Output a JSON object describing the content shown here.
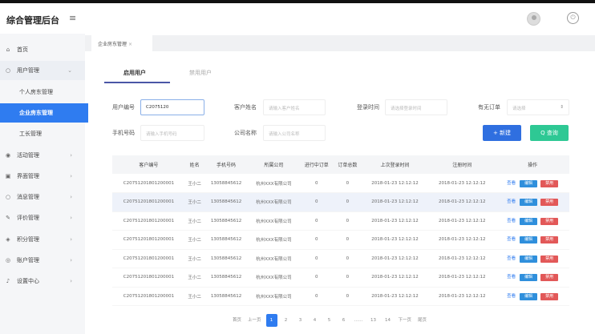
{
  "header": {
    "title": "综合管理后台",
    "menu_icon": "≡"
  },
  "sidebar": {
    "items": [
      {
        "icon": "⌂",
        "label": "首页"
      },
      {
        "icon": "○",
        "label": "用户管理",
        "arrow": "⌄"
      },
      {
        "label": "个人房东管理"
      },
      {
        "label": "企业房东管理"
      },
      {
        "label": "工长管理"
      },
      {
        "icon": "◉",
        "label": "活动管理",
        "arrow": "›"
      },
      {
        "icon": "▣",
        "label": "界面管理",
        "arrow": "›"
      },
      {
        "icon": "○",
        "label": "消息管理",
        "arrow": "›"
      },
      {
        "icon": "✎",
        "label": "评价管理",
        "arrow": "›"
      },
      {
        "icon": "◈",
        "label": "积分管理",
        "arrow": "›"
      },
      {
        "icon": "◎",
        "label": "账户管理",
        "arrow": "›"
      },
      {
        "icon": "♪",
        "label": "设置中心",
        "arrow": "›"
      }
    ]
  },
  "page_tab": {
    "label": "企业房东管理",
    "close": "×"
  },
  "subtabs": [
    "启用用户",
    "禁用用户"
  ],
  "form": {
    "customer_id": {
      "label": "用户编号",
      "value": "C2075120"
    },
    "customer_name": {
      "label": "客户姓名",
      "placeholder": "请输入客户姓名"
    },
    "login_time": {
      "label": "登录时间",
      "placeholder": "请选择登录时间"
    },
    "has_order": {
      "label": "有无订单",
      "placeholder": "请选择",
      "arrow": "⇕"
    },
    "phone": {
      "label": "手机号码",
      "placeholder": "请输入手机号码"
    },
    "company": {
      "label": "公司名称",
      "placeholder": "请输入公司名称"
    },
    "new_button": "+ 新建",
    "search_button": "Q 查询"
  },
  "table": {
    "headers": [
      "客户编号",
      "姓名",
      "手机号码",
      "所属公司",
      "进行中订单",
      "订单总数",
      "上次登录时间",
      "注册时间",
      "操作"
    ],
    "rows": [
      [
        "C20751201801200001",
        "王小二",
        "13058845612",
        "杭州XXX有限公司",
        "0",
        "0",
        "2018-01-23  12:12:12",
        "2018-01-23  12:12:12"
      ],
      [
        "C20751201801200001",
        "王小二",
        "13058845612",
        "杭州XXX有限公司",
        "0",
        "0",
        "2018-01-23  12:12:12",
        "2018-01-23  12:12:12"
      ],
      [
        "C20751201801200001",
        "王小二",
        "13058845612",
        "杭州XXX有限公司",
        "0",
        "0",
        "2018-01-23  12:12:12",
        "2018-01-23  12:12:12"
      ],
      [
        "C20751201801200001",
        "王小二",
        "13058845612",
        "杭州XXX有限公司",
        "0",
        "0",
        "2018-01-23  12:12:12",
        "2018-01-23  12:12:12"
      ],
      [
        "C20751201801200001",
        "王小二",
        "13058845612",
        "杭州XXX有限公司",
        "0",
        "0",
        "2018-01-23  12:12:12",
        "2018-01-23  12:12:12"
      ],
      [
        "C20751201801200001",
        "王小二",
        "13058845612",
        "杭州XXX有限公司",
        "0",
        "0",
        "2018-01-23  12:12:12",
        "2018-01-23  12:12:12"
      ],
      [
        "C20751201801200001",
        "王小二",
        "13058845612",
        "杭州XXX有限公司",
        "0",
        "0",
        "2018-01-23  12:12:12",
        "2018-01-23  12:12:12"
      ]
    ],
    "actions": {
      "view": "查看",
      "edit": "编辑",
      "disable": "禁用"
    }
  },
  "pagination": [
    "首页",
    "上一页",
    "1",
    "2",
    "3",
    "4",
    "5",
    "6",
    "……",
    "13",
    "14",
    "下一页",
    "尾页"
  ],
  "pagination_current": "1"
}
